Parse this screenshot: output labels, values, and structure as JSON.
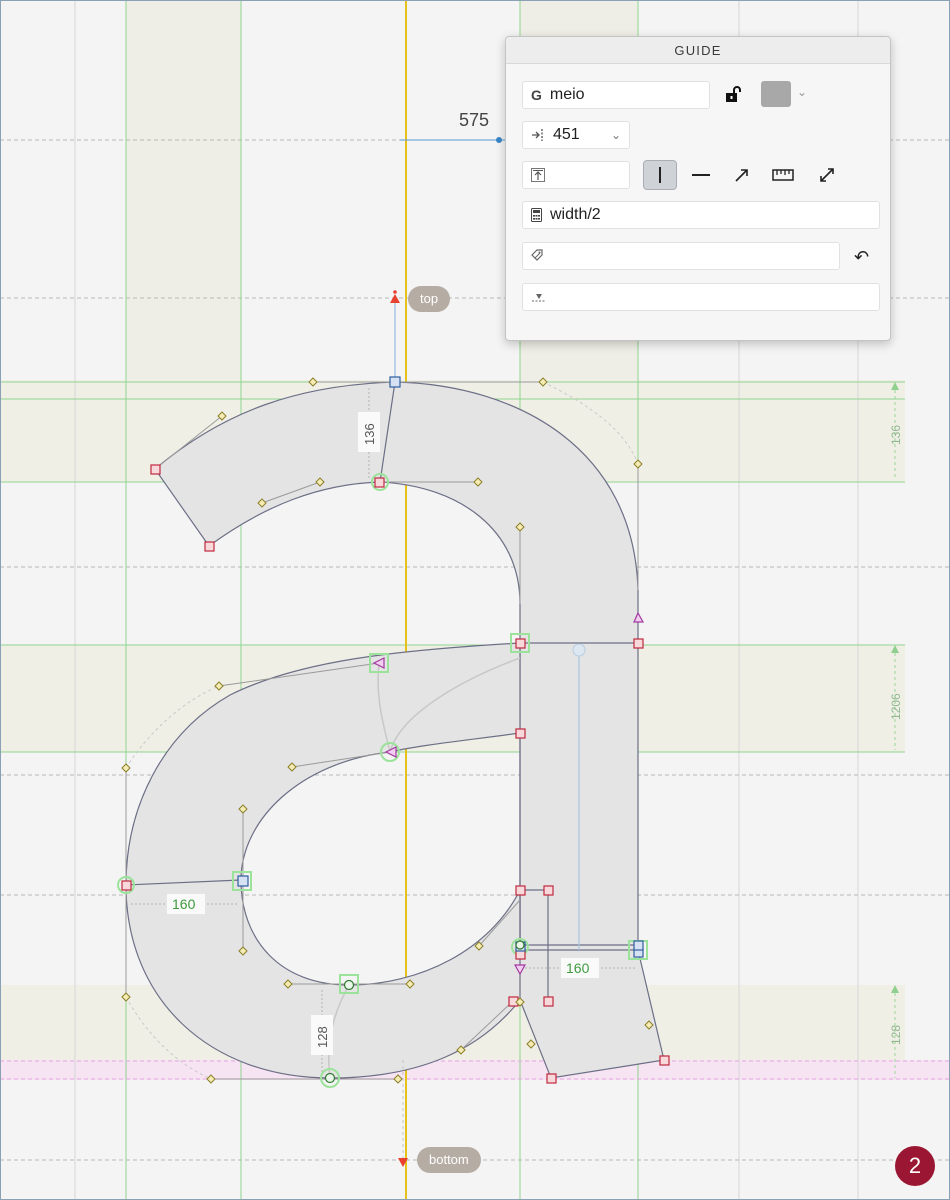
{
  "panel": {
    "title": "GUIDE",
    "name_prefix": "G",
    "name_value": "meio",
    "position_value": "451",
    "formula_value": "width/2",
    "swatch_color": "#a8a8a8"
  },
  "canvas": {
    "coord_readout": "575",
    "label_top": "top",
    "label_bottom": "bottom",
    "measure_top_stroke": "136",
    "measure_bowl_stroke": "160",
    "measure_stem_stroke": "160",
    "measure_bottom_stroke": "128",
    "ruler_top": "136",
    "ruler_middle": "1206",
    "ruler_bottom": "128"
  },
  "badge": "2",
  "colors": {
    "accent_red": "#c0283e",
    "guide_green": "#7fd27f",
    "guide_yellow": "#e4c21b",
    "glyph_fill": "#e4e4e4",
    "glyph_stroke": "#6c6f86",
    "badge_bg": "#9a1632"
  }
}
